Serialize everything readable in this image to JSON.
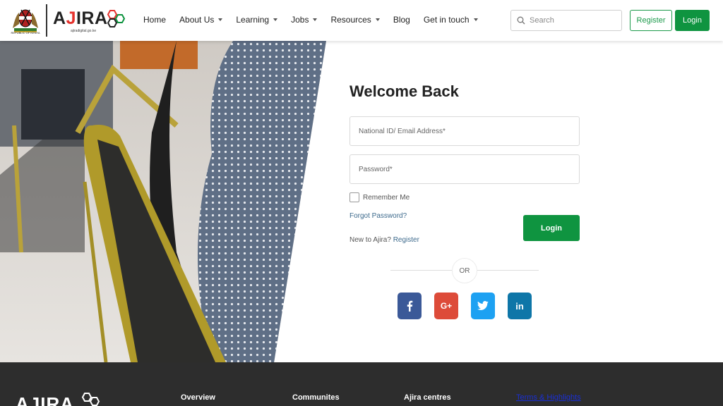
{
  "header": {
    "emblem_caption": "REPUBLIC OF KENYA",
    "logo_text_a": "A",
    "logo_text_j": "J",
    "logo_text_rest": "IRA",
    "logo_subtitle": "ajiradigital.go.ke",
    "nav": [
      {
        "label": "Home",
        "dropdown": false
      },
      {
        "label": "About Us",
        "dropdown": true
      },
      {
        "label": "Learning",
        "dropdown": true
      },
      {
        "label": "Jobs",
        "dropdown": true
      },
      {
        "label": "Resources",
        "dropdown": true
      },
      {
        "label": "Blog",
        "dropdown": false
      },
      {
        "label": "Get in touch",
        "dropdown": true
      }
    ],
    "search_placeholder": "Search",
    "register_label": "Register",
    "login_label": "Login"
  },
  "form": {
    "title": "Welcome Back",
    "id_placeholder": "National ID/ Email Address*",
    "password_placeholder": "Password*",
    "remember_label": "Remember Me",
    "forgot_label": "Forgot Password?",
    "new_prefix": "New to Ajira? ",
    "new_link": "Register",
    "login_label": "Login",
    "or_label": "OR"
  },
  "social": [
    {
      "name": "facebook",
      "glyph": "f",
      "color": "#3b5998"
    },
    {
      "name": "google-plus",
      "glyph": "G+",
      "color": "#dd4b39"
    },
    {
      "name": "twitter",
      "glyph": "t",
      "color": "#1da1f2"
    },
    {
      "name": "linkedin",
      "glyph": "in",
      "color": "#0e76a8"
    }
  ],
  "footer": {
    "logo": "AJIRA",
    "columns": [
      "Overview",
      "Communites",
      "Ajira centres"
    ],
    "link": "Terms & Highlights"
  },
  "colors": {
    "brand_green": "#0f9440",
    "brand_red": "#e5322d",
    "footer_bg": "#2d2d2d"
  }
}
